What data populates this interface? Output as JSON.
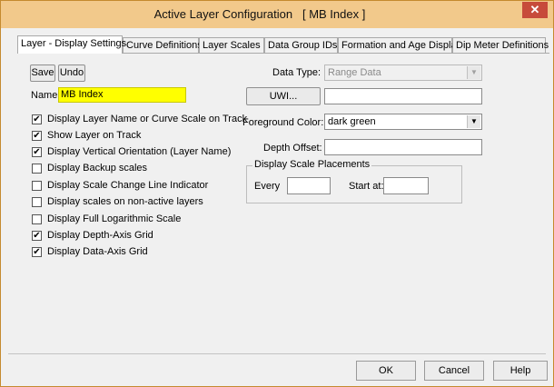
{
  "window": {
    "title": "Active Layer Configuration",
    "title_tag": "[ MB Index ]",
    "close_glyph": "✕"
  },
  "tabs": [
    {
      "label": "Layer - Display Settings",
      "active": true
    },
    {
      "label": "Curve Definitions",
      "active": false
    },
    {
      "label": "Layer Scales",
      "active": false
    },
    {
      "label": "Data Group IDs",
      "active": false
    },
    {
      "label": "Formation and Age Display",
      "active": false
    },
    {
      "label": "Dip Meter Definitions",
      "active": false
    }
  ],
  "left": {
    "save_label": "Save",
    "undo_label": "Undo",
    "name_label": "Name:",
    "name_value": "MB Index",
    "name_highlight": "#ffff00",
    "checkboxes": [
      {
        "label": "Display Layer Name or Curve Scale on Track",
        "checked": true
      },
      {
        "label": "Show Layer on Track",
        "checked": true
      },
      {
        "label": "Display Vertical Orientation (Layer Name)",
        "checked": true
      },
      {
        "label": "Display Backup scales",
        "checked": false
      },
      {
        "label": "Display Scale Change Line Indicator",
        "checked": false
      },
      {
        "label": "Display scales on non-active layers",
        "checked": false
      },
      {
        "label": "Display Full Logarithmic Scale",
        "checked": false
      },
      {
        "label": "Display Depth-Axis Grid",
        "checked": true
      },
      {
        "label": "Display Data-Axis Grid",
        "checked": true
      }
    ]
  },
  "right": {
    "data_type_label": "Data Type:",
    "data_type_value": "Range Data",
    "uwi_button": "UWI...",
    "uwi_value": "",
    "fg_color_label": "Foreground Color:",
    "fg_color_value": "dark green",
    "depth_offset_label": "Depth Offset:",
    "depth_offset_value": "",
    "scale_group_title": "Display Scale Placements",
    "every_label": "Every",
    "every_value": "",
    "start_at_label": "Start at:",
    "start_at_value": ""
  },
  "footer": {
    "ok_label": "OK",
    "cancel_label": "Cancel",
    "help_label": "Help"
  },
  "icons": {
    "dropdown": "▼",
    "check": "✔"
  },
  "colors": {
    "titlebar": "#f2c98b",
    "close_button": "#c74b3b"
  }
}
